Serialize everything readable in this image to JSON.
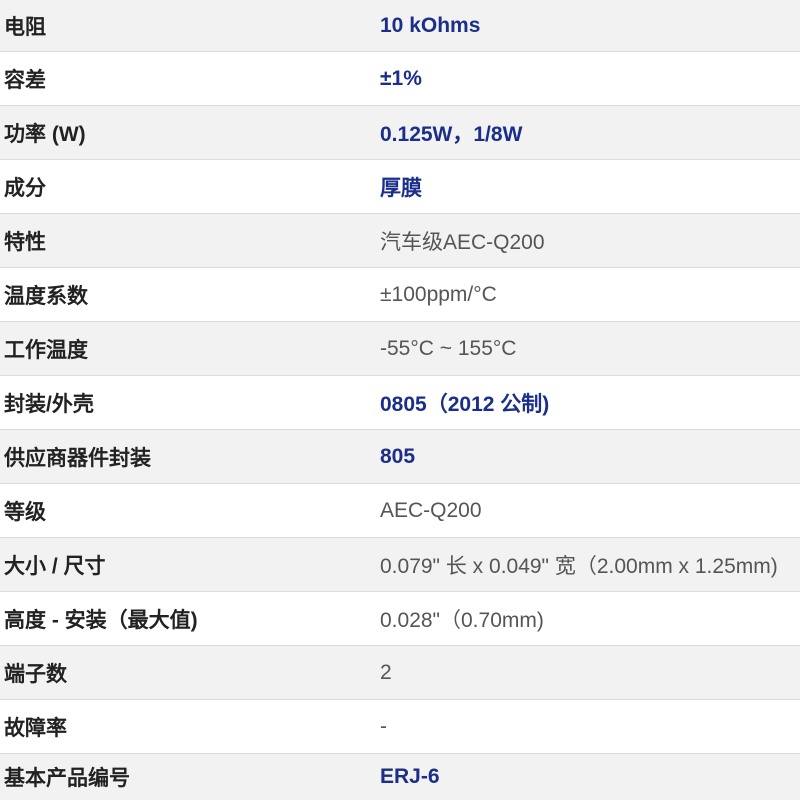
{
  "specs": [
    {
      "label": "电阻",
      "value": "10 kOhms",
      "link": true
    },
    {
      "label": "容差",
      "value": "±1%",
      "link": true
    },
    {
      "label": "功率 (W)",
      "value": "0.125W，1/8W",
      "link": true
    },
    {
      "label": "成分",
      "value": "厚膜",
      "link": true
    },
    {
      "label": "特性",
      "value": "汽车级AEC-Q200",
      "link": false
    },
    {
      "label": "温度系数",
      "value": "±100ppm/°C",
      "link": false
    },
    {
      "label": "工作温度",
      "value": "-55°C ~ 155°C",
      "link": false
    },
    {
      "label": "封装/外壳",
      "value": "0805（2012 公制)",
      "link": true
    },
    {
      "label": "供应商器件封装",
      "value": "805",
      "link": true
    },
    {
      "label": "等级",
      "value": "AEC-Q200",
      "link": false
    },
    {
      "label": "大小 / 尺寸",
      "value": "0.079\" 长 x 0.049\" 宽（2.00mm x 1.25mm)",
      "link": false
    },
    {
      "label": "高度 - 安装（最大值)",
      "value": "0.028\"（0.70mm)",
      "link": false
    },
    {
      "label": "端子数",
      "value": "2",
      "link": false
    },
    {
      "label": "故障率",
      "value": "-",
      "link": false
    },
    {
      "label": "基本产品编号",
      "value": "ERJ-6",
      "link": true
    }
  ]
}
